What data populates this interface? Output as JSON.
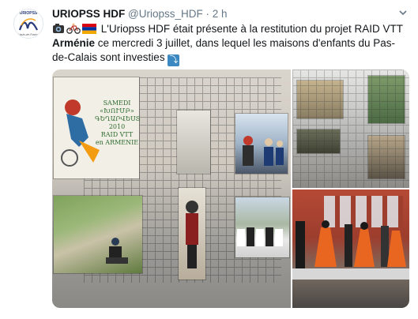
{
  "account": {
    "display_name": "URIOPSS HDF",
    "handle": "@Uriopss_HDF",
    "separator": "·",
    "time": "2 h",
    "avatar_logo": "URIOPSS",
    "avatar_tagline": "Hauts-de-France"
  },
  "tweet": {
    "emojis": [
      "camera-emoji",
      "bicycle-emoji",
      "armenia-flag-emoji"
    ],
    "text_part1": "L'Uriopss HDF était présente à la restitution du projet RAID VTT",
    "bold_word": "Arménie",
    "text_part2": " ce mercredi 3 juillet, dans lequel les maisons d'enfants du Pas-de-Calais sont investies",
    "trailing_emoji": "⤵️"
  },
  "media": {
    "photo1_poster_lines": [
      "SAMEDI",
      "«ԽՈՒՄԲ»",
      "ԳԵՂԱՐՎԵՍՏ",
      "2010",
      "RAID VTT",
      "en ARMENIE"
    ]
  },
  "colors": {
    "name": "#14171a",
    "secondary": "#657786",
    "link_emoji_bg": "#3b88c3"
  },
  "icons": {
    "caret": "chevron-down-icon"
  }
}
